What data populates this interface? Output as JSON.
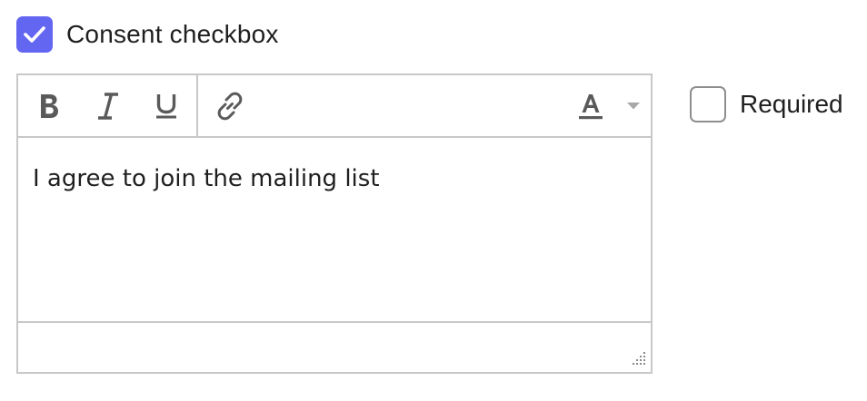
{
  "consent": {
    "label": "Consent checkbox",
    "checked": true,
    "accent_color": "#6366f1"
  },
  "editor": {
    "toolbar": {
      "bold_icon": "bold-icon",
      "italic_icon": "italic-icon",
      "underline_icon": "underline-icon",
      "link_icon": "link-icon",
      "text_color_icon": "text-color-icon",
      "text_color_dropdown_icon": "chevron-down-icon"
    },
    "content": "I agree to join the mailing list"
  },
  "required": {
    "label": "Required",
    "checked": false
  }
}
